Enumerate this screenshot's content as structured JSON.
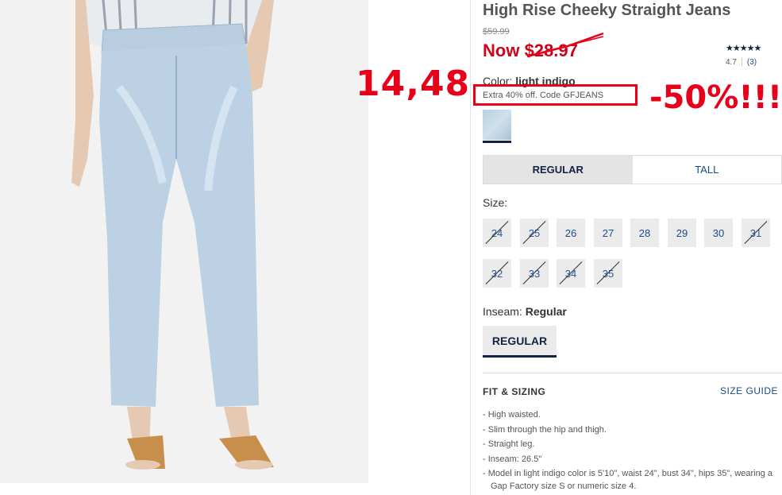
{
  "product": {
    "title": "High Rise Cheeky Straight Jeans",
    "old_price": "$59.99",
    "now_prefix": "Now ",
    "now_price": "$28.97",
    "stars": "★★★★★",
    "rating": "4.7",
    "review_count": "(3)"
  },
  "color": {
    "label": "Color:",
    "value": "light indigo",
    "promo": "Extra 40% off. Code GFJEANS",
    "swatch_hex": "#c3d7e7"
  },
  "fit_tabs": [
    {
      "label": "REGULAR",
      "active": true
    },
    {
      "label": "TALL",
      "active": false
    }
  ],
  "size": {
    "label": "Size:",
    "options": [
      {
        "label": "24",
        "available": false
      },
      {
        "label": "25",
        "available": false
      },
      {
        "label": "26",
        "available": true
      },
      {
        "label": "27",
        "available": true
      },
      {
        "label": "28",
        "available": true
      },
      {
        "label": "29",
        "available": true
      },
      {
        "label": "30",
        "available": true
      },
      {
        "label": "31",
        "available": false
      },
      {
        "label": "32",
        "available": false
      },
      {
        "label": "33",
        "available": false
      },
      {
        "label": "34",
        "available": false
      },
      {
        "label": "35",
        "available": false
      }
    ]
  },
  "inseam": {
    "label": "Inseam:",
    "value": "Regular",
    "button": "REGULAR"
  },
  "details": {
    "heading": "FIT & SIZING",
    "size_guide": "SIZE GUIDE",
    "bullets": [
      "High waisted.",
      "Slim through the hip and thigh.",
      "Straight leg.",
      "Inseam: 26.5\"",
      "Model in light indigo color is 5'10\", waist 24\", bust 34\", hips 35\", wearing a Gap Factory size S or numeric size 4."
    ]
  },
  "annotations": {
    "price_note": "14,48",
    "percent_note": "-50%!!!",
    "color_hex": "#e8001a"
  },
  "colors": {
    "navy": "#122344",
    "link": "#1a4a8a",
    "sale_red": "#d0021b",
    "denim": "#b9cfe0"
  }
}
